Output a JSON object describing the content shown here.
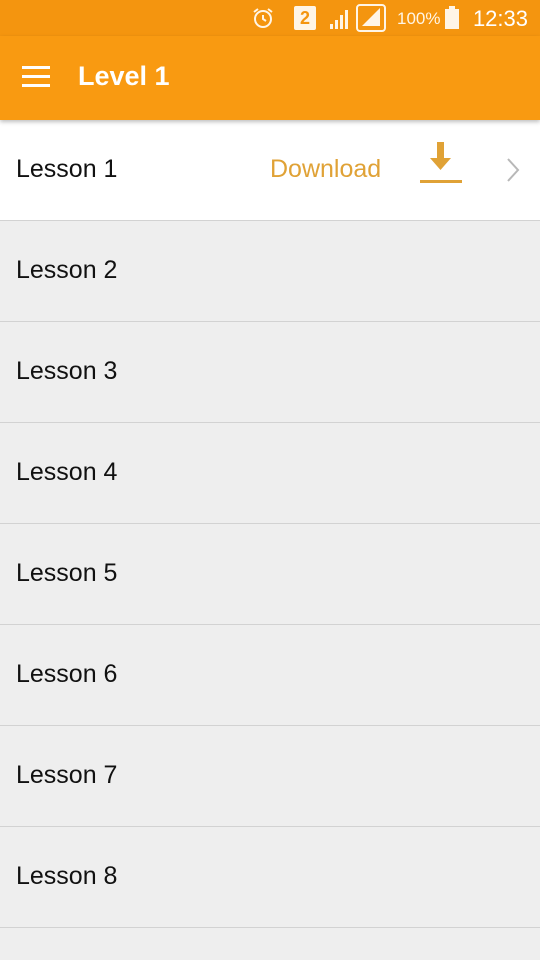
{
  "status_bar": {
    "sim_slot": "2",
    "battery": "100%",
    "time": "12:33",
    "icons": [
      "alarm-icon",
      "sim-2-icon",
      "signal-icon",
      "no-sim-signal-icon",
      "battery-icon"
    ]
  },
  "app_bar": {
    "title": "Level 1",
    "menu_icon": "menu-icon",
    "color": "#f99a11"
  },
  "lessons": [
    {
      "label": "Lesson 1",
      "action": "Download",
      "active": true
    },
    {
      "label": "Lesson 2"
    },
    {
      "label": "Lesson 3"
    },
    {
      "label": "Lesson 4"
    },
    {
      "label": "Lesson 5"
    },
    {
      "label": "Lesson 6"
    },
    {
      "label": "Lesson 7"
    },
    {
      "label": "Lesson 8"
    }
  ],
  "colors": {
    "accent": "#e0a236",
    "list_bg": "#eeeeee",
    "active_row_bg": "#ffffff"
  }
}
